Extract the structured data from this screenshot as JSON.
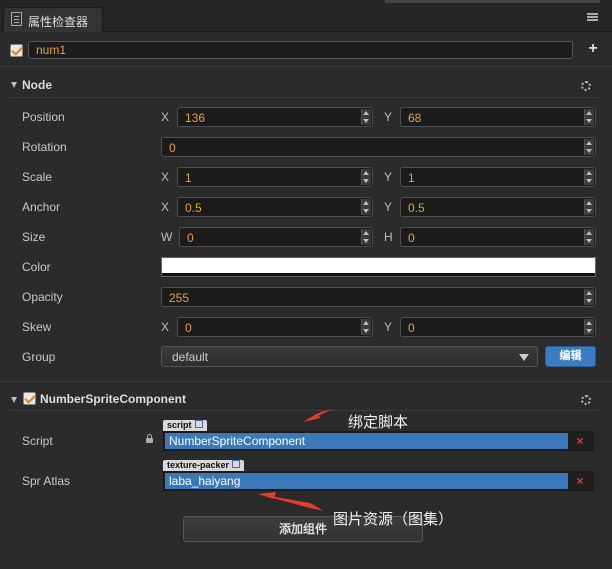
{
  "panel": {
    "title": "属性检查器"
  },
  "node_name": "num1",
  "node_section": {
    "title": "Node",
    "props": {
      "position": {
        "label": "Position",
        "x_label": "X",
        "x": "136",
        "y_label": "Y",
        "y": "68"
      },
      "rotation": {
        "label": "Rotation",
        "value": "0"
      },
      "scale": {
        "label": "Scale",
        "x_label": "X",
        "x": "1",
        "y_label": "Y",
        "y": "1"
      },
      "anchor": {
        "label": "Anchor",
        "x_label": "X",
        "x": "0.5",
        "y_label": "Y",
        "y": "0.5"
      },
      "size": {
        "label": "Size",
        "w_label": "W",
        "w": "0",
        "h_label": "H",
        "h": "0"
      },
      "color": {
        "label": "Color",
        "value": "#ffffff"
      },
      "opacity": {
        "label": "Opacity",
        "value": "255"
      },
      "skew": {
        "label": "Skew",
        "x_label": "X",
        "x": "0",
        "y_label": "Y",
        "y": "0"
      },
      "group": {
        "label": "Group",
        "value": "default",
        "edit_label": "编辑"
      }
    }
  },
  "component": {
    "title": "NumberSpriteComponent",
    "script": {
      "label": "Script",
      "tag": "script",
      "value": "NumberSpriteComponent"
    },
    "spr_atlas": {
      "label": "Spr Atlas",
      "tag": "texture-packer",
      "value": "laba_haiyang"
    },
    "clear_glyph": "×"
  },
  "add_component_label": "添加组件",
  "annotations": {
    "bind_script": "绑定脚本",
    "image_resource": "图片资源（图集）"
  },
  "colors": {
    "accent_orange": "#e8a03a",
    "asset_blue": "#3a78b8",
    "edit_blue": "#3b7cc0",
    "arrow_red": "#e63b2e"
  }
}
